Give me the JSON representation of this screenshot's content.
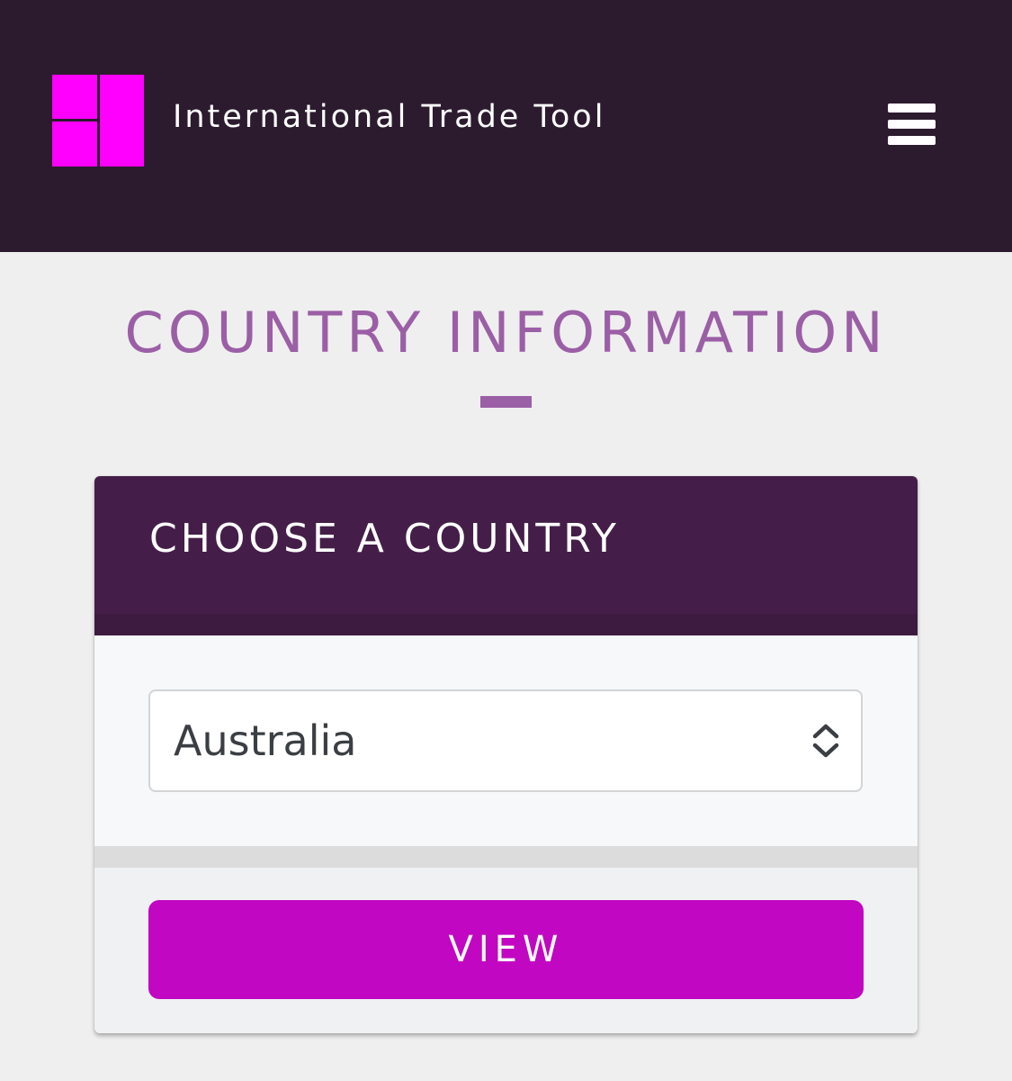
{
  "header": {
    "app_title": "International Trade Tool",
    "logo_icon": "grid-logo-icon",
    "menu_icon": "hamburger-menu-icon",
    "background_color": "#2c1b2e",
    "logo_color": "#ff00ff"
  },
  "main": {
    "page_title": "COUNTRY INFORMATION",
    "title_color": "#9b5fa6"
  },
  "card": {
    "title": "CHOOSE A COUNTRY",
    "header_color": "#441e48",
    "country_select": {
      "selected_value": "Australia",
      "icon": "up-down-chevron-icon"
    },
    "view_button_label": "VIEW",
    "button_color": "#c107c1"
  }
}
